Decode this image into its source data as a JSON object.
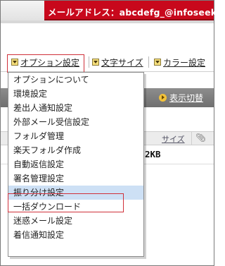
{
  "header": {
    "email_label": "メールアドレス：abcdefg_@infoseek.jp"
  },
  "toolbar": {
    "items": [
      {
        "label": "オプション設定",
        "icon": "dropdown-arrow-icon"
      },
      {
        "label": "文字サイズ",
        "icon": "dropdown-arrow-icon"
      },
      {
        "label": "カラー設定",
        "icon": "dropdown-arrow-icon"
      }
    ]
  },
  "view_switch": {
    "label": "表示切替",
    "icon": "play-circle-icon"
  },
  "list_header": {
    "size": "サイズ",
    "attachment_icon": "paperclip-icon"
  },
  "row": {
    "size_value": "2KB"
  },
  "menu": {
    "items": [
      {
        "label": "オプションについて"
      },
      {
        "label": "環境設定"
      },
      {
        "label": "差出人通知設定"
      },
      {
        "label": "外部メール受信設定"
      },
      {
        "label": "フォルダ管理"
      },
      {
        "label": "楽天フォルダ作成"
      },
      {
        "label": "自動返信設定"
      },
      {
        "label": "署名管理設定"
      },
      {
        "label": "振り分け設定",
        "active": true
      },
      {
        "label": "一括ダウンロード"
      },
      {
        "label": "迷惑メール設定"
      },
      {
        "label": "着信通知設定"
      }
    ]
  },
  "colors": {
    "banner": "#c8081c",
    "highlight_border": "#d0303a",
    "menu_active": "#cde0f5"
  }
}
